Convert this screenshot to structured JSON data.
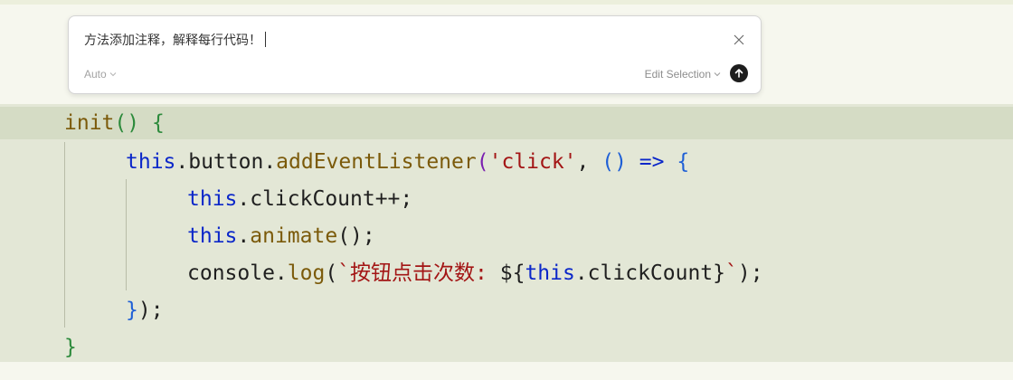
{
  "prompt": {
    "input_text": "方法添加注释，解释每行代码！",
    "mode_label": "Auto",
    "edit_selection_label": "Edit Selection",
    "close_icon": "close-icon",
    "submit_icon": "arrow-up-icon"
  },
  "code": {
    "l1": {
      "a": "init",
      "b": "(",
      "c": ")",
      "d": " ",
      "e": "{"
    },
    "l2": {
      "a": "this",
      "b": ".button.",
      "c": "addEventListener",
      "d": "(",
      "e": "'click'",
      "f": ", ",
      "g": "()",
      "h": " => ",
      "i": "{"
    },
    "l3": {
      "a": "this",
      "b": ".clickCount++;"
    },
    "l4": {
      "a": "this",
      "b": ".",
      "c": "animate",
      "d": "();"
    },
    "l5": {
      "a": "console.",
      "b": "log",
      "c": "(",
      "d": "`按钮点击次数: ",
      "e": "${",
      "f": "this",
      "g": ".clickCount",
      "h": "}",
      "i": "`",
      "j": ");"
    },
    "l6": {
      "a": "}",
      "b": ");"
    },
    "l7": {
      "a": "}"
    }
  },
  "colors": {
    "keyword": "#0b27c9",
    "function": "#7b5a0a",
    "string": "#a31515",
    "bracket_level1": "#2c8a3b",
    "bracket_level2": "#7a1fb0",
    "bracket_level3": "#1e5fd6",
    "editor_background": "#e3e7d6"
  }
}
